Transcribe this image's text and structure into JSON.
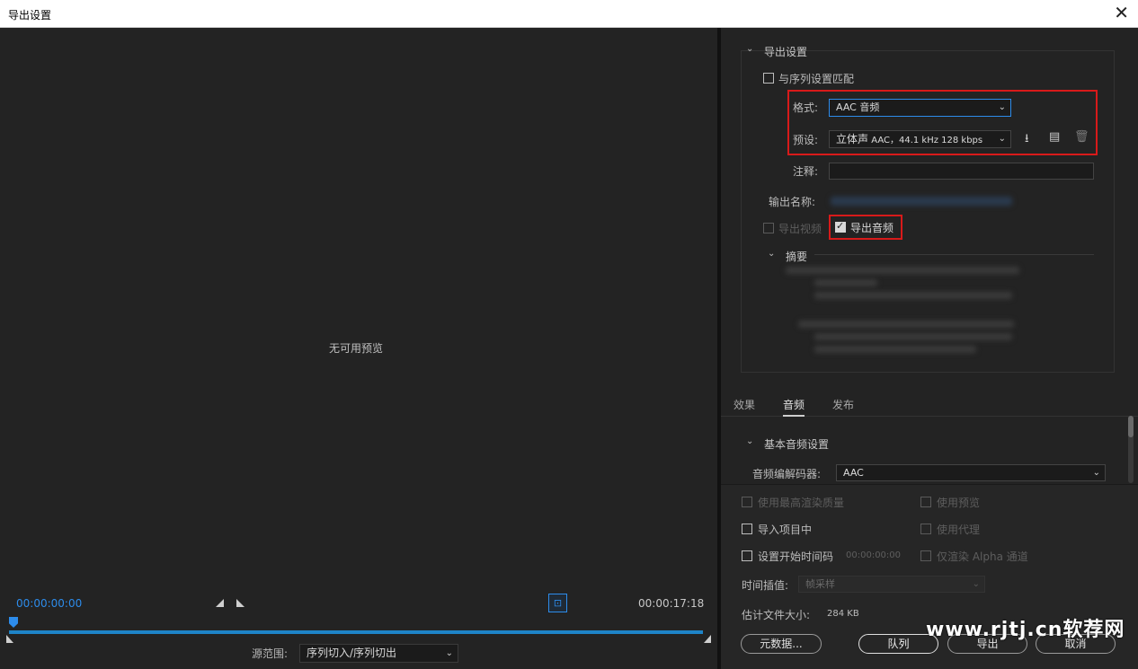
{
  "window": {
    "title": "导出设置",
    "close_icon": "close-icon"
  },
  "preview": {
    "no_preview_text": "无可用预览",
    "timecode_start": "00:00:00:00",
    "timecode_end": "00:00:17:18",
    "source_range_label": "源范围:",
    "source_range_value": "序列切入/序列切出"
  },
  "export_settings": {
    "header": "导出设置",
    "match_sequence_label": "与序列设置匹配",
    "match_sequence_checked": false,
    "format_label": "格式:",
    "format_value": "AAC 音频",
    "preset_label": "预设:",
    "preset_value_main": "立体声",
    "preset_value_detail": "AAC，44.1 kHz 128 kbps",
    "comment_label": "注释:",
    "comment_value": "",
    "output_name_label": "输出名称:",
    "export_video_label": "导出视频",
    "export_video_checked": false,
    "export_audio_label": "导出音频",
    "export_audio_checked": true,
    "summary_header": "摘要"
  },
  "tabs": [
    {
      "label": "效果"
    },
    {
      "label": "音频"
    },
    {
      "label": "发布"
    }
  ],
  "active_tab": "音频",
  "audio_settings": {
    "header": "基本音频设置",
    "codec_label": "音频编解码器:",
    "codec_value": "AAC"
  },
  "options": {
    "max_render_quality": "使用最高渲染质量",
    "use_preview": "使用预览",
    "import_to_project": "导入项目中",
    "use_proxy": "使用代理",
    "set_start_timecode": "设置开始时间码",
    "start_timecode_value": "00:00:00:00",
    "render_alpha_only": "仅渲染 Alpha 通道",
    "time_interpolation_label": "时间插值:",
    "time_interpolation_value": "帧采样",
    "est_file_size_label": "估计文件大小:",
    "est_file_size_value": "284 KB"
  },
  "buttons": {
    "metadata": "元数据...",
    "queue": "队列",
    "export": "导出",
    "cancel": "取消"
  },
  "watermark": "www.rjtj.cn软荐网",
  "colors": {
    "accent_blue": "#2d8ceb",
    "highlight_red": "#d81a1a",
    "background": "#232323"
  }
}
